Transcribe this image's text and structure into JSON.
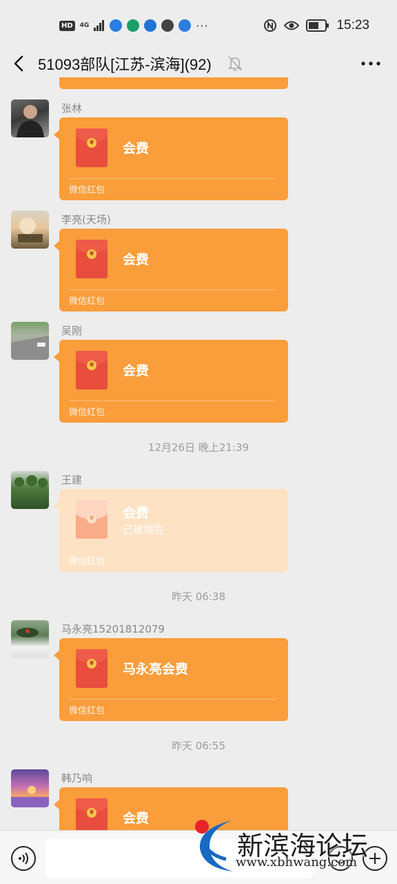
{
  "status_bar": {
    "hd": "HD",
    "network": "4G",
    "more": "···",
    "time": "15:23"
  },
  "header": {
    "title": "51093部队[江苏-滨海](92)"
  },
  "messages": [
    {
      "sender": "张林",
      "packet_title": "会费",
      "packet_label": "微信红包"
    },
    {
      "sender": "李亮(天场)",
      "packet_title": "会费",
      "packet_label": "微信红包"
    },
    {
      "sender": "吴刚",
      "packet_title": "会费",
      "packet_label": "微信红包"
    },
    {
      "sender": "王建",
      "packet_title": "会费",
      "packet_status": "已被领完",
      "packet_label": "微信红包"
    },
    {
      "sender": "马永亮15201812079",
      "packet_title": "马永亮会费",
      "packet_label": "微信红包"
    },
    {
      "sender": "韩乃响",
      "packet_title": "会费"
    }
  ],
  "timestamps": [
    "12月26日 晚上21:39",
    "昨天 06:38",
    "昨天 06:55"
  ],
  "coin_symbol": "¥",
  "watermark": {
    "name": "新滨海论坛",
    "url": "www.xbhwang.com"
  },
  "colors": {
    "packet": "#fa9d3b",
    "packet_opened": "#fde2c4",
    "envelope": "#e84d3d"
  }
}
